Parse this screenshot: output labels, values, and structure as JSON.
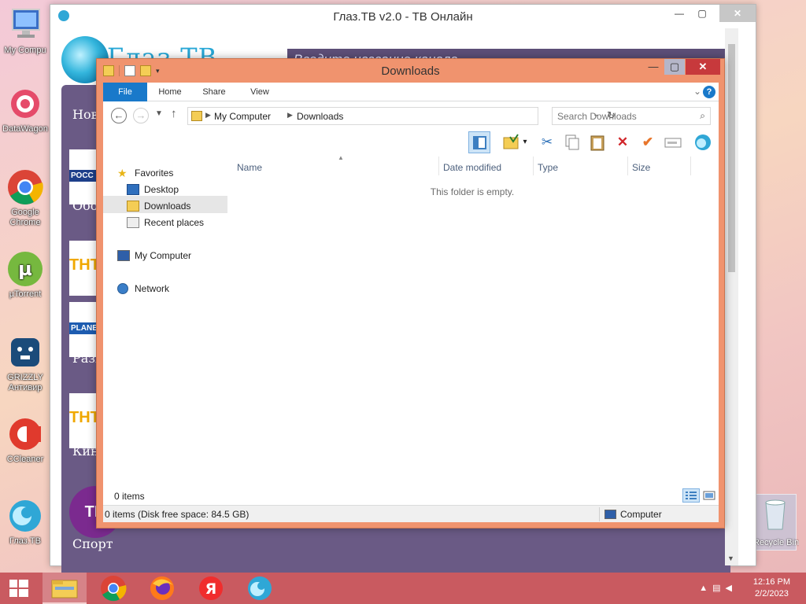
{
  "desktop": {
    "icons": [
      {
        "label": "My Compu"
      },
      {
        "label": "DataWagon"
      },
      {
        "label": "Google Chrome"
      },
      {
        "label": "µTorrent"
      },
      {
        "label": "GRIZZLY Антивир"
      },
      {
        "label": "CCleaner"
      },
      {
        "label": "Глаз.ТВ"
      }
    ],
    "recycle_bin": "Recycle Bin"
  },
  "app": {
    "title": "Глаз.ТВ v2.0 - ТВ Онлайн",
    "brand": "Глаз.ТВ",
    "search_placeholder": "Введите название канала",
    "categories": [
      "Нов",
      "Обо",
      "Разв",
      "Кин",
      "Спорт"
    ],
    "thumbs": [
      "РОСС",
      "ТНТ",
      "PLANE",
      "ТНТ",
      "ТВ"
    ]
  },
  "explorer": {
    "title": "Downloads",
    "tabs": {
      "file": "File",
      "home": "Home",
      "share": "Share",
      "view": "View"
    },
    "breadcrumb": [
      "My Computer",
      "Downloads"
    ],
    "search_placeholder": "Search Downloads",
    "nav": {
      "favorites": "Favorites",
      "desktop": "Desktop",
      "downloads": "Downloads",
      "recent": "Recent places",
      "computer": "My Computer",
      "network": "Network"
    },
    "columns": {
      "name": "Name",
      "date": "Date modified",
      "type": "Type",
      "size": "Size"
    },
    "empty_message": "This folder is empty.",
    "items_count": "0 items",
    "status": "0 items (Disk free space: 84.5 GB)",
    "status_location": "Computer"
  },
  "taskbar": {
    "time": "12:16 PM",
    "date": "2/2/2023"
  }
}
